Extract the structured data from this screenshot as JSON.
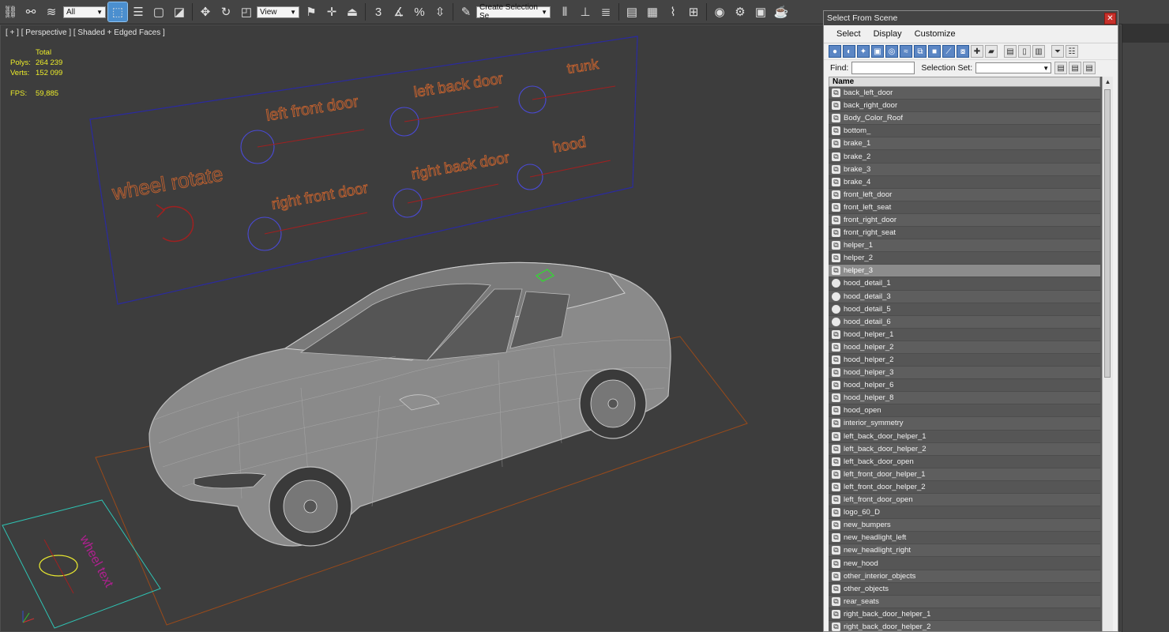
{
  "toolbar": {
    "filter_value": "All",
    "refcoord_value": "View",
    "named_set_placeholder": "Create Selection Se",
    "snap_label": "3",
    "percent_label": "%"
  },
  "viewport": {
    "label": "[ + ] [ Perspective ] [ Shaded + Edged Faces ]",
    "stats": {
      "total_label": "Total",
      "polys_label": "Polys:",
      "polys_value": "264 239",
      "verts_label": "Verts:",
      "verts_value": "152 099",
      "fps_label": "FPS:",
      "fps_value": "59,885"
    },
    "scene_texts": {
      "wheel_rotate": "wheel rotate",
      "left_front_door": "left front door",
      "left_back_door": "left back door",
      "trunk": "trunk",
      "right_front_door": "right front door",
      "right_back_door": "right back door",
      "hood": "hood",
      "wheel_text": "wheel text"
    },
    "colors": {
      "text_orange": "#c4622f",
      "circle_blue": "#4a4ad8",
      "line_red": "#a02020",
      "frame_blue": "#2a2aa0",
      "ground_orange": "#9a4a1a"
    }
  },
  "dialog": {
    "title": "Select From Scene",
    "menu": {
      "select": "Select",
      "display": "Display",
      "customize": "Customize"
    },
    "find_label": "Find:",
    "selection_set_label": "Selection Set:",
    "column_name": "Name",
    "items": [
      {
        "name": "back_left_door",
        "icon": "helper-icon"
      },
      {
        "name": "back_right_door",
        "icon": "helper-icon"
      },
      {
        "name": "Body_Color_Roof",
        "icon": "helper-icon"
      },
      {
        "name": "bottom_",
        "icon": "helper-icon"
      },
      {
        "name": "brake_1",
        "icon": "helper-icon"
      },
      {
        "name": "brake_2",
        "icon": "helper-icon"
      },
      {
        "name": "brake_3",
        "icon": "helper-icon"
      },
      {
        "name": "brake_4",
        "icon": "helper-icon"
      },
      {
        "name": "front_left_door",
        "icon": "helper-icon"
      },
      {
        "name": "front_left_seat",
        "icon": "helper-icon"
      },
      {
        "name": "front_right_door",
        "icon": "helper-icon"
      },
      {
        "name": "front_right_seat",
        "icon": "helper-icon"
      },
      {
        "name": "helper_1",
        "icon": "helper-icon"
      },
      {
        "name": "helper_2",
        "icon": "helper-icon"
      },
      {
        "name": "helper_3",
        "icon": "helper-icon",
        "selected": true
      },
      {
        "name": "hood_detail_1",
        "icon": "sphere-icon"
      },
      {
        "name": "hood_detail_3",
        "icon": "sphere-icon"
      },
      {
        "name": "hood_detail_5",
        "icon": "sphere-icon"
      },
      {
        "name": "hood_detail_6",
        "icon": "sphere-icon"
      },
      {
        "name": "hood_helper_1",
        "icon": "helper-icon"
      },
      {
        "name": "hood_helper_2",
        "icon": "helper-icon"
      },
      {
        "name": "hood_helper_2",
        "icon": "helper-icon"
      },
      {
        "name": "hood_helper_3",
        "icon": "helper-icon"
      },
      {
        "name": "hood_helper_6",
        "icon": "helper-icon"
      },
      {
        "name": "hood_helper_8",
        "icon": "helper-icon"
      },
      {
        "name": "hood_open",
        "icon": "helper-icon"
      },
      {
        "name": "interior_symmetry",
        "icon": "helper-icon"
      },
      {
        "name": "left_back_door_helper_1",
        "icon": "helper-icon"
      },
      {
        "name": "left_back_door_helper_2",
        "icon": "helper-icon"
      },
      {
        "name": "left_back_door_open",
        "icon": "helper-icon"
      },
      {
        "name": "left_front_door_helper_1",
        "icon": "helper-icon"
      },
      {
        "name": "left_front_door_helper_2",
        "icon": "helper-icon"
      },
      {
        "name": "left_front_door_open",
        "icon": "helper-icon"
      },
      {
        "name": "logo_60_D",
        "icon": "helper-icon"
      },
      {
        "name": "new_bumpers",
        "icon": "helper-icon"
      },
      {
        "name": "new_headlight_left",
        "icon": "helper-icon"
      },
      {
        "name": "new_headlight_right",
        "icon": "helper-icon"
      },
      {
        "name": "new_hood",
        "icon": "helper-icon"
      },
      {
        "name": "other_interior_objects",
        "icon": "helper-icon"
      },
      {
        "name": "other_objects",
        "icon": "helper-icon"
      },
      {
        "name": "rear_seats",
        "icon": "helper-icon"
      },
      {
        "name": "right_back_door_helper_1",
        "icon": "helper-icon"
      },
      {
        "name": "right_back_door_helper_2",
        "icon": "helper-icon"
      }
    ]
  }
}
